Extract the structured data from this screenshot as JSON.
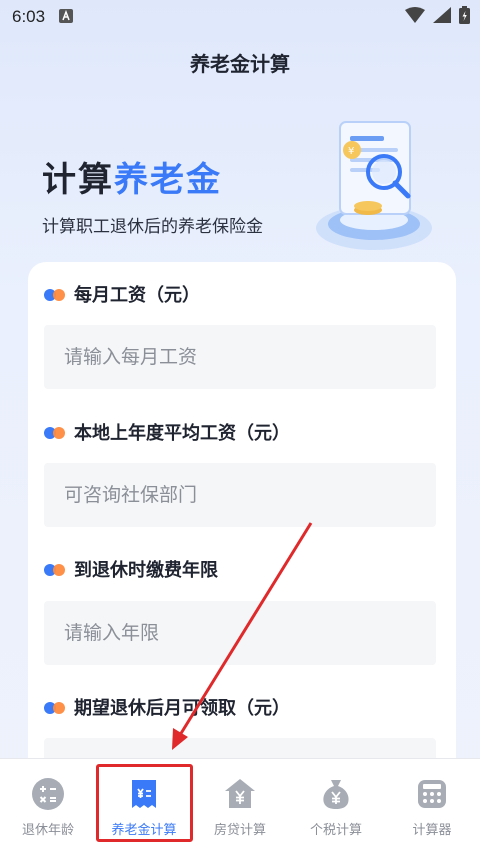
{
  "status_bar": {
    "time": "6:03"
  },
  "header": {
    "title": "养老金计算"
  },
  "hero": {
    "title_part1": "计算",
    "title_part2": "养老金",
    "subtitle": "计算职工退休后的养老保险金"
  },
  "form": {
    "fields": [
      {
        "label": "每月工资（元）",
        "placeholder": "请输入每月工资"
      },
      {
        "label": "本地上年度平均工资（元）",
        "placeholder": "可咨询社保部门"
      },
      {
        "label": "到退休时缴费年限",
        "placeholder": "请输入年限"
      },
      {
        "label": "期望退休后月可领取（元）",
        "placeholder": ""
      }
    ]
  },
  "bottom_nav": {
    "items": [
      {
        "label": "退休年龄",
        "icon": "calculator-icon"
      },
      {
        "label": "养老金计算",
        "icon": "receipt-icon"
      },
      {
        "label": "房贷计算",
        "icon": "house-yen-icon"
      },
      {
        "label": "个税计算",
        "icon": "money-bag-icon"
      },
      {
        "label": "计算器",
        "icon": "keypad-icon"
      }
    ],
    "active_index": 1
  },
  "colors": {
    "accent": "#3a79f7",
    "annotation_red": "#e0292a"
  }
}
